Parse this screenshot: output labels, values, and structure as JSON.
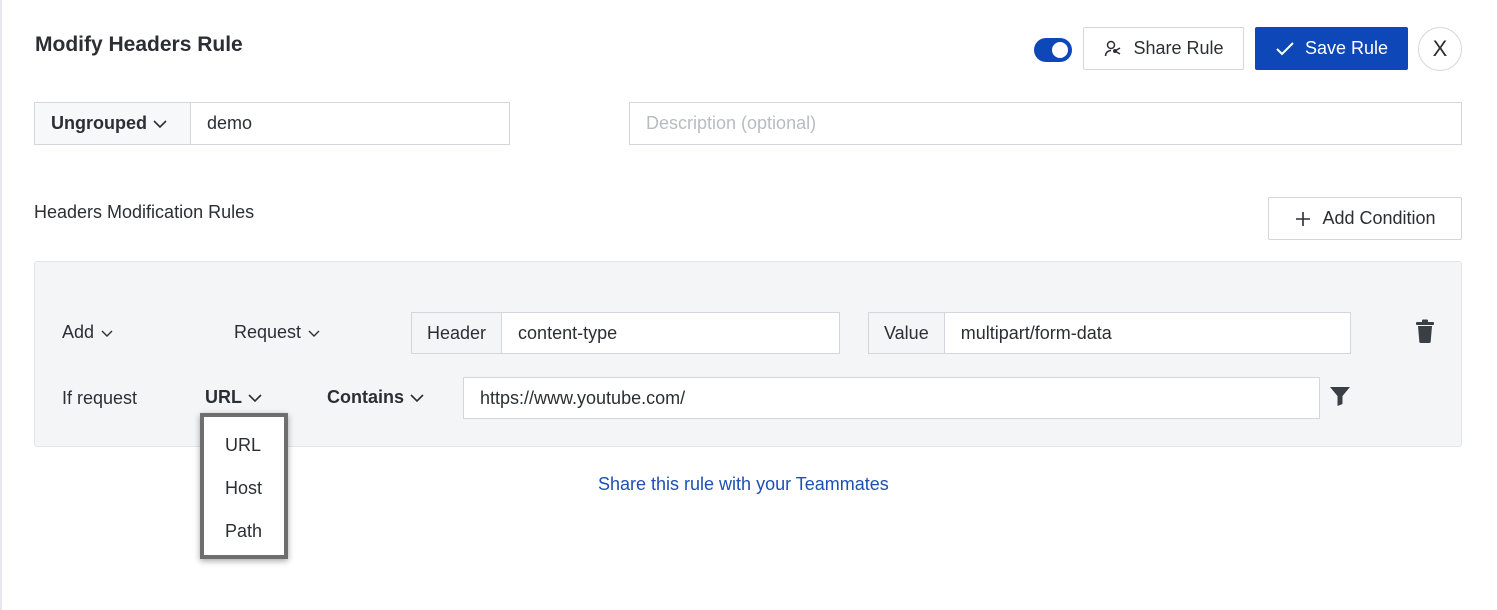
{
  "header": {
    "title": "Modify Headers Rule",
    "toggle_on": true,
    "share_label": "Share Rule",
    "save_label": "Save Rule",
    "close_label": "X"
  },
  "rule_meta": {
    "group": "Ungrouped",
    "name": "demo",
    "description_placeholder": "Description (optional)"
  },
  "section": {
    "label": "Headers Modification Rules",
    "add_condition_label": "Add Condition"
  },
  "modification": {
    "action": "Add",
    "type": "Request",
    "header_key_label": "Header",
    "header_value": "content-type",
    "value_key_label": "Value",
    "value_value": "multipart/form-data"
  },
  "condition": {
    "prefix": "If request",
    "source": "URL",
    "operator": "Contains",
    "url": "https://www.youtube.com/"
  },
  "source_menu": {
    "options": [
      "URL",
      "Host",
      "Path"
    ]
  },
  "share_link_label": "Share this rule with your Teammates",
  "colors": {
    "primary": "#0d47b8",
    "link": "#1f4fb3",
    "panel_bg": "#f4f5f7",
    "border": "#d3d6da"
  }
}
